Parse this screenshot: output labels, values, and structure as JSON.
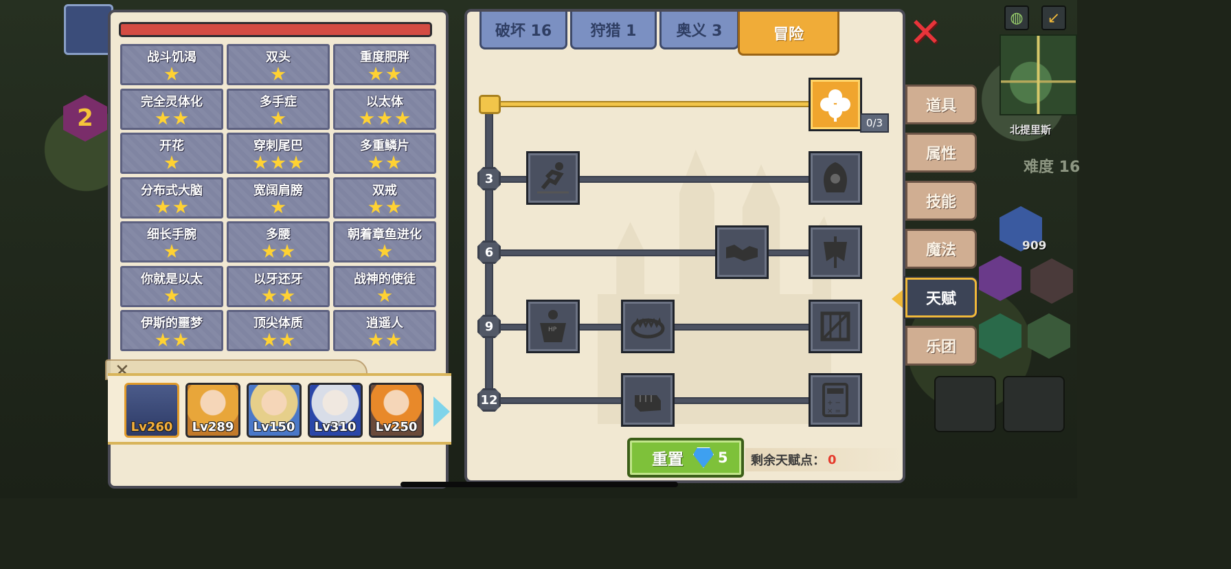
{
  "top_tabs": [
    {
      "label": "破坏 16"
    },
    {
      "label": "狩猎 1"
    },
    {
      "label": "奥义 3"
    },
    {
      "label": "冒险"
    }
  ],
  "traits": [
    {
      "name": "战斗饥渴",
      "stars": 1
    },
    {
      "name": "双头",
      "stars": 1
    },
    {
      "name": "重度肥胖",
      "stars": 2
    },
    {
      "name": "完全灵体化",
      "stars": 2
    },
    {
      "name": "多手症",
      "stars": 1
    },
    {
      "name": "以太体",
      "stars": 3
    },
    {
      "name": "开花",
      "stars": 1
    },
    {
      "name": "穿刺尾巴",
      "stars": 3
    },
    {
      "name": "多重鳞片",
      "stars": 2
    },
    {
      "name": "分布式大脑",
      "stars": 2
    },
    {
      "name": "宽阔肩膀",
      "stars": 1
    },
    {
      "name": "双戒",
      "stars": 2
    },
    {
      "name": "细长手腕",
      "stars": 1
    },
    {
      "name": "多腰",
      "stars": 2
    },
    {
      "name": "朝着章鱼进化",
      "stars": 1
    },
    {
      "name": "你就是以太",
      "stars": 1
    },
    {
      "name": "以牙还牙",
      "stars": 2
    },
    {
      "name": "战神的使徒",
      "stars": 1
    },
    {
      "name": "伊斯的噩梦",
      "stars": 2
    },
    {
      "name": "顶尖体质",
      "stars": 2
    },
    {
      "name": "逍遥人",
      "stars": 2
    }
  ],
  "heroes": [
    {
      "level": "Lv260",
      "selected": true
    },
    {
      "level": "Lv289",
      "selected": false
    },
    {
      "level": "Lv150",
      "selected": false
    },
    {
      "level": "Lv310",
      "selected": false
    },
    {
      "level": "Lv250",
      "selected": false
    }
  ],
  "talent_tree": {
    "clover_progress": "0/3",
    "rows": [
      {
        "level": "3",
        "talents": [
          "sprint-icon",
          "hooded-figure-icon"
        ]
      },
      {
        "level": "6",
        "talents": [
          "handshake-icon",
          "war-banner-icon"
        ]
      },
      {
        "level": "9",
        "talents": [
          "hp-muscle-icon",
          "bear-trap-icon",
          "crate-icon"
        ]
      },
      {
        "level": "12",
        "talents": [
          "fist-icon",
          "calculator-icon"
        ]
      }
    ]
  },
  "reset": {
    "label": "重置",
    "cost": "5"
  },
  "remaining_points": {
    "label": "剩余天赋点：",
    "value": "0"
  },
  "side_tabs": [
    {
      "label": "道具",
      "active": false
    },
    {
      "label": "属性",
      "active": false
    },
    {
      "label": "技能",
      "active": false
    },
    {
      "label": "魔法",
      "active": false
    },
    {
      "label": "天赋",
      "active": true
    },
    {
      "label": "乐团",
      "active": false
    }
  ],
  "world": {
    "map_location": "北提里斯",
    "difficulty": "难度 16",
    "hud_level": "2",
    "item_count": "909"
  },
  "colors": {
    "panel_bg": "#f1e8d2",
    "trait_cell": "#8085a2",
    "star": "#ffd233",
    "active_tab": "#f0ac38",
    "reset_button": "#7ec13a",
    "points_value": "#e53a2c"
  }
}
